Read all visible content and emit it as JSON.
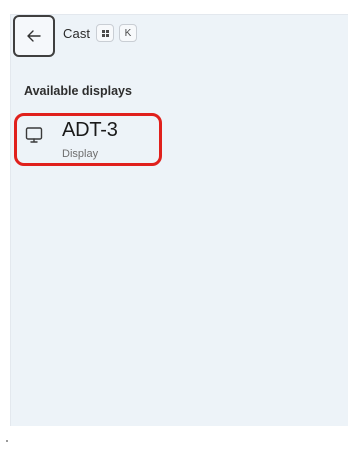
{
  "header": {
    "title": "Cast",
    "shortcut_key": "K"
  },
  "section": {
    "title": "Available displays"
  },
  "displays": [
    {
      "name": "ADT-3",
      "subtitle": "Display"
    }
  ],
  "icons": {
    "back": "arrow-left-icon",
    "windows_key": "windows-key-icon",
    "display": "monitor-icon"
  },
  "colors": {
    "panel_bg": "#edf3f8",
    "highlight": "#e0201c"
  }
}
